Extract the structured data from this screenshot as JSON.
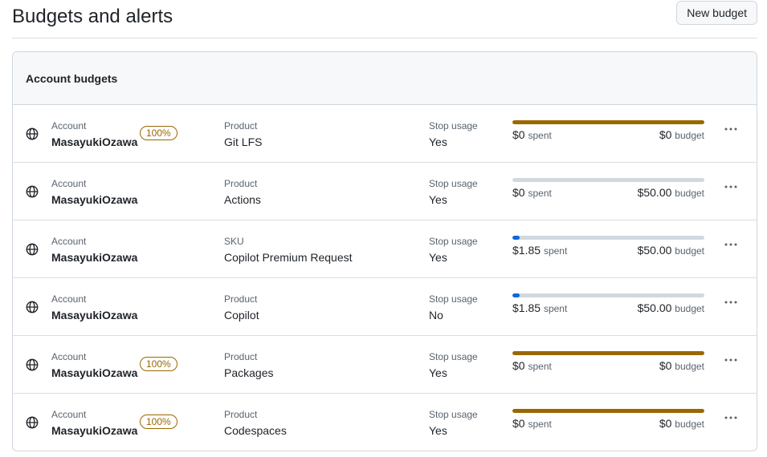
{
  "page": {
    "title": "Budgets and alerts",
    "new_budget_label": "New budget"
  },
  "section": {
    "title": "Account budgets"
  },
  "colors": {
    "over_budget": "#9a6700",
    "progress": "#0969da",
    "track": "#d1d9e0"
  },
  "budgets": [
    {
      "scope_label": "Account",
      "account": "MasayukiOzawa",
      "badge": "100%",
      "type_label": "Product",
      "type_value": "Git LFS",
      "stop_label": "Stop usage",
      "stop_value": "Yes",
      "spent": "$0",
      "spent_suffix": "spent",
      "budget": "$0",
      "budget_suffix": "budget",
      "progress": 1.0,
      "over": true
    },
    {
      "scope_label": "Account",
      "account": "MasayukiOzawa",
      "badge": "",
      "type_label": "Product",
      "type_value": "Actions",
      "stop_label": "Stop usage",
      "stop_value": "Yes",
      "spent": "$0",
      "spent_suffix": "spent",
      "budget": "$50.00",
      "budget_suffix": "budget",
      "progress": 0.0,
      "over": false
    },
    {
      "scope_label": "Account",
      "account": "MasayukiOzawa",
      "badge": "",
      "type_label": "SKU",
      "type_value": "Copilot Premium Request",
      "stop_label": "Stop usage",
      "stop_value": "Yes",
      "spent": "$1.85",
      "spent_suffix": "spent",
      "budget": "$50.00",
      "budget_suffix": "budget",
      "progress": 0.037,
      "over": false
    },
    {
      "scope_label": "Account",
      "account": "MasayukiOzawa",
      "badge": "",
      "type_label": "Product",
      "type_value": "Copilot",
      "stop_label": "Stop usage",
      "stop_value": "No",
      "spent": "$1.85",
      "spent_suffix": "spent",
      "budget": "$50.00",
      "budget_suffix": "budget",
      "progress": 0.037,
      "over": false
    },
    {
      "scope_label": "Account",
      "account": "MasayukiOzawa",
      "badge": "100%",
      "type_label": "Product",
      "type_value": "Packages",
      "stop_label": "Stop usage",
      "stop_value": "Yes",
      "spent": "$0",
      "spent_suffix": "spent",
      "budget": "$0",
      "budget_suffix": "budget",
      "progress": 1.0,
      "over": true
    },
    {
      "scope_label": "Account",
      "account": "MasayukiOzawa",
      "badge": "100%",
      "type_label": "Product",
      "type_value": "Codespaces",
      "stop_label": "Stop usage",
      "stop_value": "Yes",
      "spent": "$0",
      "spent_suffix": "spent",
      "budget": "$0",
      "budget_suffix": "budget",
      "progress": 1.0,
      "over": true
    }
  ]
}
